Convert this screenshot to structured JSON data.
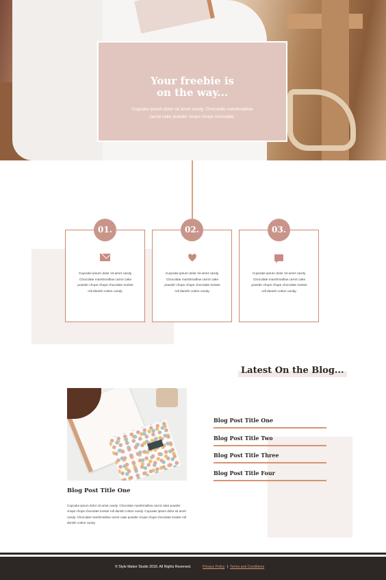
{
  "hero": {
    "title": "Your freebie is on the way...",
    "body": "Cupcake ipsum dolor sit amet candy. Chocolate marshmallow carrot cake powder chups chups chocolate."
  },
  "steps": [
    {
      "number": "01.",
      "icon": "mail-icon",
      "text": "Cupcake ipsum dolor sit amet candy. Chocolate marshmallow carrot cake powder chups chups chocolate tootsie roll danish cotton candy."
    },
    {
      "number": "02.",
      "icon": "heart-icon",
      "text": "Cupcake ipsum dolor sit amet candy. Chocolate marshmallow carrot cake powder chups chups chocolate tootsie roll danish cotton candy."
    },
    {
      "number": "03.",
      "icon": "chat-icon",
      "text": "Cupcake ipsum dolor sit amet candy. Chocolate marshmallow carrot cake powder chups chups chocolate tootsie roll danish cotton candy."
    }
  ],
  "blog": {
    "heading": "Latest On the Blog...",
    "featured": {
      "title": "Blog Post Title One",
      "excerpt": "Cupcake ipsum dolor sit amet candy. Chocolate marshmallow carrot cake powder chups chups chocolate tootsie roll danish cotton candy. Cupcake ipsum dolor sit amet candy. Chocolate marshmallow carrot cake powder chups chups chocolate tootsie roll danish cotton candy."
    },
    "list": [
      "Blog Post Title One",
      "Blog Post Title Two",
      "Blog Post Title Three",
      "Blog Post Title Four"
    ]
  },
  "footer": {
    "copyright": "© Style Maker Studio 2018. All Rights Reserved.",
    "privacy": "Privacy Policy",
    "separator": "|",
    "terms": "Terms and Conditions"
  },
  "colors": {
    "accent": "#d8926e",
    "card": "#e1c6bf",
    "badge": "#c9958b",
    "footer": "#2d2826"
  }
}
